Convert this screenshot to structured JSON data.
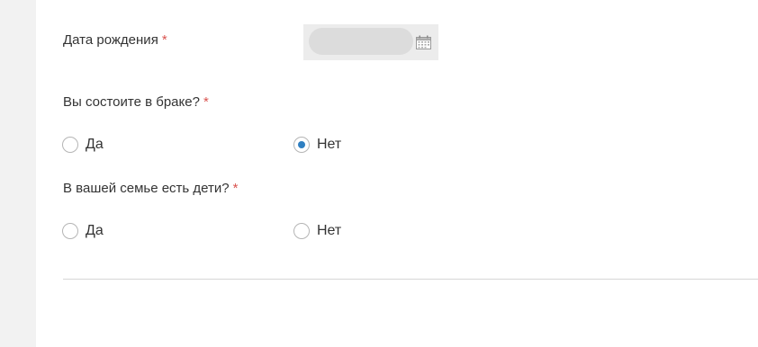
{
  "birth_date": {
    "label": "Дата рождения",
    "required_mark": "*",
    "value": "",
    "icon": "calendar-icon"
  },
  "married": {
    "question": "Вы состоите в браке?",
    "required_mark": "*",
    "options": [
      {
        "label": "Да",
        "checked": false
      },
      {
        "label": "Нет",
        "checked": true
      }
    ]
  },
  "children": {
    "question": "В вашей семье есть дети?",
    "required_mark": "*",
    "options": [
      {
        "label": "Да",
        "checked": false
      },
      {
        "label": "Нет",
        "checked": false
      }
    ]
  },
  "colors": {
    "required": "#d9534f",
    "radio_selected": "#2f7fc1",
    "gutter": "#f2f2f2"
  }
}
